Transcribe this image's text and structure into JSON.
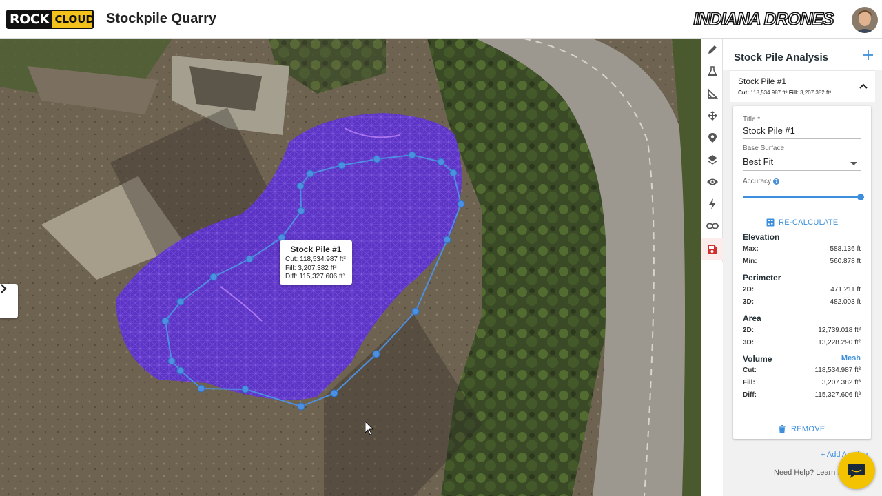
{
  "header": {
    "logo_left": "ROCK",
    "logo_right": "CLOUD",
    "project_title": "Stockpile Quarry",
    "brand": "INDIANA DRONES"
  },
  "tooltip": {
    "title": "Stock Pile #1",
    "cut": "Cut: 118,534.987 ft³",
    "fill": "Fill: 3,207.382 ft³",
    "diff": "Diff: 115,327.606 ft³"
  },
  "toolbar": {
    "tools": [
      "pencil-icon",
      "flask-icon",
      "angle-ruler-icon",
      "move-icon",
      "location-pin-icon",
      "layers-icon",
      "eye-icon",
      "lightning-icon",
      "link-icon",
      "save-icon"
    ]
  },
  "panel": {
    "title": "Stock Pile Analysis",
    "pile": {
      "name": "Stock Pile #1",
      "cut_label": "Cut:",
      "cut_value": "118,534.987 ft³",
      "fill_label": "Fill:",
      "fill_value": "3,207.382 ft³"
    },
    "form": {
      "title_label": "Title *",
      "title_value": "Stock Pile #1",
      "base_label": "Base Surface",
      "base_value": "Best Fit",
      "accuracy_label": "Accuracy",
      "accuracy_level": 1.0,
      "recalculate": "RE-CALCULATE"
    },
    "elevation": {
      "title": "Elevation",
      "max_label": "Max:",
      "max": "588.136 ft",
      "min_label": "Min:",
      "min": "560.878 ft"
    },
    "perimeter": {
      "title": "Perimeter",
      "d2_label": "2D:",
      "d2": "471.211 ft",
      "d3_label": "3D:",
      "d3": "482.003 ft"
    },
    "area": {
      "title": "Area",
      "d2_label": "2D:",
      "d2": "12,739.018 ft²",
      "d3_label": "3D:",
      "d3": "13,228.290 ft²"
    },
    "volume": {
      "title": "Volume",
      "mode": "Mesh",
      "cut_label": "Cut:",
      "cut": "118,534.987 ft³",
      "fill_label": "Fill:",
      "fill": "3,207.382 ft³",
      "diff_label": "Diff:",
      "diff": "115,327.606 ft³"
    },
    "remove": "REMOVE",
    "add_another": "+ Add Another",
    "need_help": "Need Help? Learn M"
  },
  "colors": {
    "accent": "#3d8fdc",
    "mesh": "#5b2fd6",
    "logo_yellow": "#f2c21a",
    "save_red": "#d32f2f"
  }
}
